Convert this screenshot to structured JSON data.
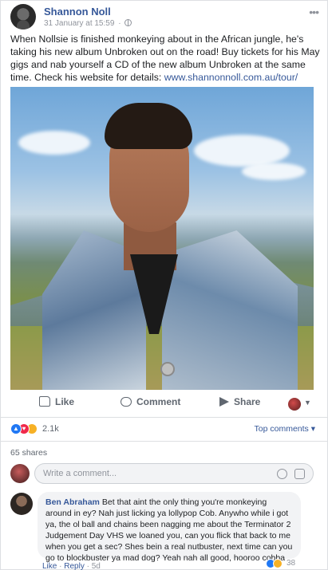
{
  "post": {
    "author": "Shannon Noll",
    "timestamp": "31 January at 15:59",
    "separator": "·",
    "more_icon": "more-horizontal-icon",
    "text_main": "When Nollsie is finished monkeying about in the African jungle, he's taking his new album Unbroken out on the road! Buy tickets for his May gigs and nab yourself a CD of the new album Unbroken at the same time. Check his website for details: ",
    "link": "www.shannonnoll.com.au/tour/"
  },
  "actions": {
    "like": "Like",
    "comment": "Comment",
    "share": "Share"
  },
  "reactions": {
    "count": "2.1k",
    "top_comments": "Top comments ▾"
  },
  "shares": "65 shares",
  "comment_box": {
    "placeholder": "Write a comment..."
  },
  "comments": [
    {
      "author": "Ben Abraham",
      "text": "Bet that aint the only thing you're monkeying around in ey? Nah just licking ya lollypop Cob. Anywho while i got ya, the ol ball and chains been nagging me about the Terminator 2 Judgement Day VHS we loaned you, can you flick that back to me when you get a sec? Shes bein a real nutbuster, next time can you go to blockbuster ya mad dog? Yeah nah all good, hooroo cobba",
      "reaction_count": "38",
      "like": "Like",
      "reply": "Reply",
      "age": "5d"
    }
  ],
  "colors": {
    "link": "#365899",
    "meta": "#90949c",
    "like_reaction": "#2078f4",
    "love_reaction": "#f0284a",
    "wow_reaction": "#f7b125"
  }
}
